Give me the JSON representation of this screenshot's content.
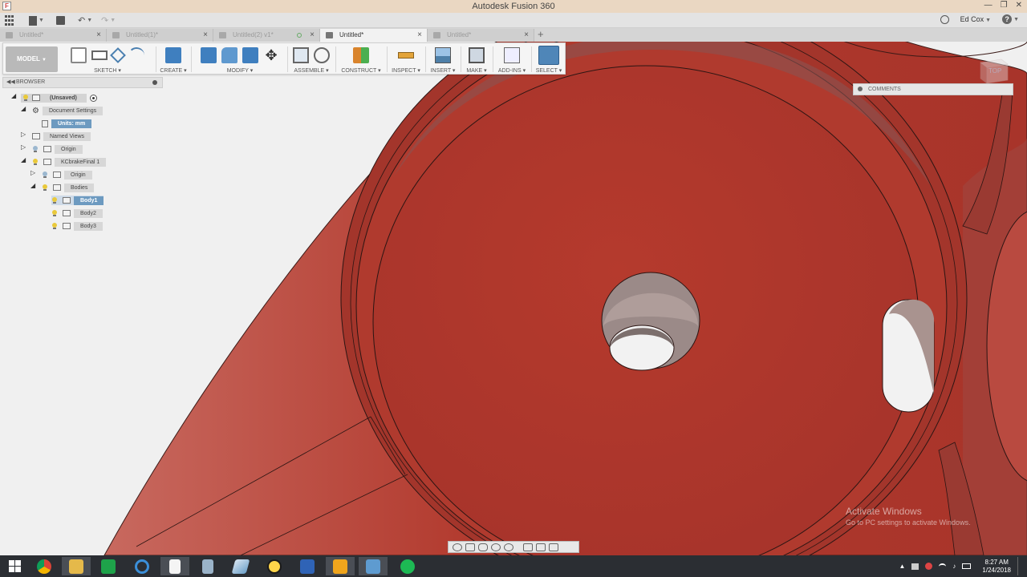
{
  "window": {
    "title": "Autodesk Fusion 360"
  },
  "quick_access": {
    "user_name": "Ed Cox"
  },
  "tabs": [
    {
      "label": "Untitled*",
      "active": false
    },
    {
      "label": "Untitled(1)*",
      "active": false
    },
    {
      "label": "Untitled(2) v1*",
      "active": false
    },
    {
      "label": "Untitled*",
      "active": true
    },
    {
      "label": "Untitled*",
      "active": false
    }
  ],
  "toolbar": {
    "workspace": "MODEL",
    "groups": [
      "SKETCH",
      "CREATE",
      "MODIFY",
      "ASSEMBLE",
      "CONSTRUCT",
      "INSPECT",
      "INSERT",
      "MAKE",
      "ADD-INS",
      "SELECT"
    ]
  },
  "browser": {
    "title": "BROWSER",
    "root": "(Unsaved)",
    "document_settings": "Document Settings",
    "units": "Units: mm",
    "named_views": "Named Views",
    "origin": "Origin",
    "component": "KCbrakeFinal 1",
    "component_origin": "Origin",
    "bodies": "Bodies",
    "body_items": [
      "Body1",
      "Body2",
      "Body3"
    ]
  },
  "comments": {
    "label": "COMMENTS"
  },
  "viewcube": {
    "face": "TOP"
  },
  "watermark": {
    "line1": "Activate Windows",
    "line2": "Go to PC settings to activate Windows."
  },
  "tray": {
    "time": "8:27 AM",
    "date": "1/24/2018"
  },
  "colors": {
    "part": "#b33a2e",
    "selection": "#6d9ac0",
    "title_bar": "#ead7c2"
  },
  "icons": {
    "taskbar": [
      "windows-start-icon",
      "chrome-icon",
      "file-explorer-icon",
      "store-icon",
      "internet-explorer-icon",
      "notepad-icon",
      "calculator-icon",
      "fusion360-icon",
      "app-icon",
      "app-icon",
      "app-icon",
      "app-icon",
      "spotify-icon"
    ]
  }
}
